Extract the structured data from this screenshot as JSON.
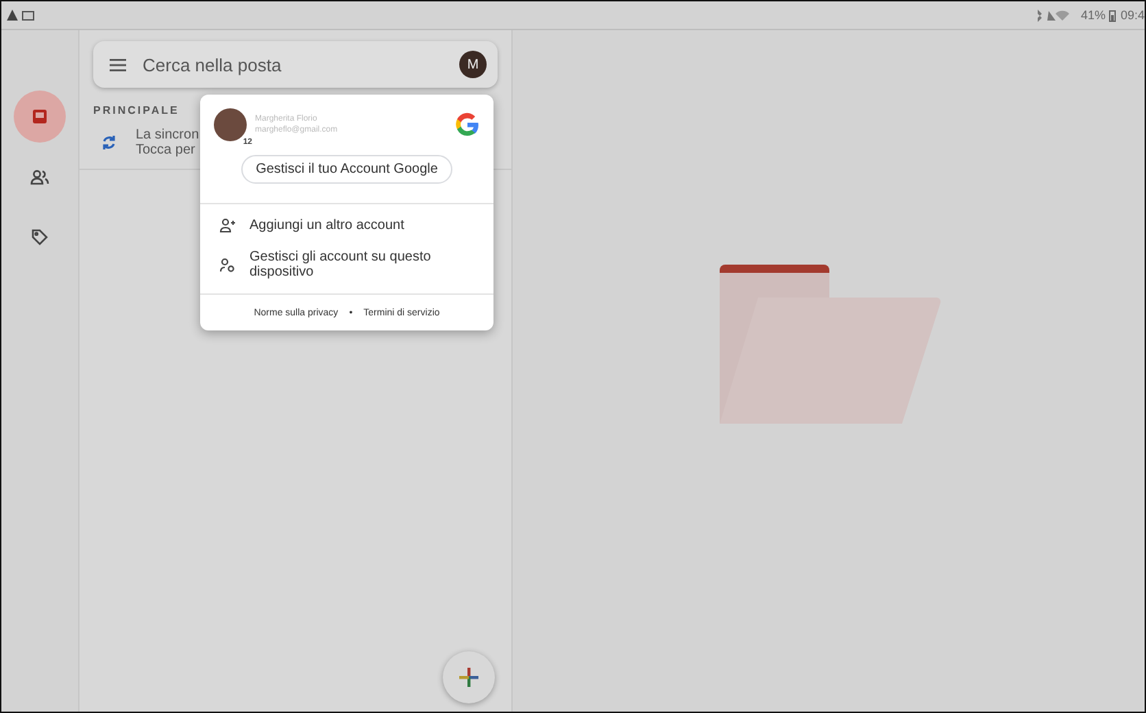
{
  "status_bar": {
    "battery": "41%",
    "time": "09:4"
  },
  "rail": [
    {
      "kind": "inbox",
      "selected": true
    },
    {
      "kind": "people",
      "selected": false
    },
    {
      "kind": "tag",
      "selected": false
    }
  ],
  "search": {
    "placeholder": "Cerca nella posta",
    "avatar": "M"
  },
  "section_title": "PRINCIPALE",
  "sync_row": {
    "line_1": "La sincron",
    "line_2": "Tocca per"
  },
  "account_menu": {
    "name": "Margherita Florio",
    "email": "margheflo@gmail.com",
    "badge": "12",
    "manage_button": "Gestisci il tuo Account Google",
    "items": [
      {
        "kind": "add",
        "label": "Aggiungi un altro account"
      },
      {
        "kind": "devices",
        "label": "Gestisci gli account su questo dispositivo"
      }
    ],
    "footer": [
      "Norme sulla privacy",
      "•",
      "Termini di servizio"
    ]
  }
}
